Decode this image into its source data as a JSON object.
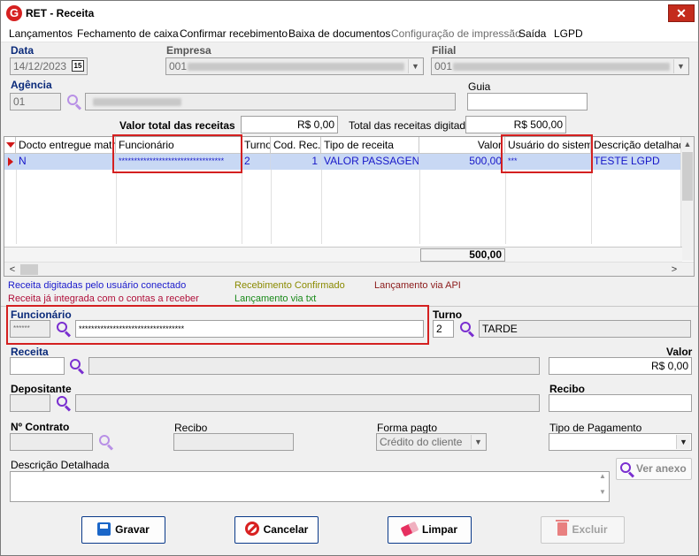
{
  "window": {
    "title": "RET - Receita",
    "icon_letter": "G",
    "close_glyph": "✕"
  },
  "menu": [
    "Lançamentos",
    "Fechamento de caixa",
    "Confirmar recebimento",
    "Baixa de documentos",
    "Configuração de impressão",
    "Saída",
    "LGPD"
  ],
  "menu_disabled_index": 4,
  "header": {
    "data_label": "Data",
    "data_value": "14/12/2023",
    "calendar_day": "15",
    "empresa_label": "Empresa",
    "empresa_code": "001",
    "filial_label": "Filial",
    "filial_code": "001",
    "agencia_label": "Agência",
    "agencia_code": "01",
    "guia_label": "Guia",
    "guia_value": ""
  },
  "totals": {
    "valor_total_label": "Valor total das receitas",
    "valor_total_value": "R$ 0,00",
    "total_digitadas_label": "Total das receitas digitadas",
    "total_digitadas_value": "R$ 500,00"
  },
  "grid": {
    "columns": [
      "Docto entregue matriz",
      "Funcionário",
      "Turno",
      "Cod. Rec.",
      "Tipo de receita",
      "Valor",
      "Usuário do sistema",
      "Descrição detalhada"
    ],
    "rows": [
      [
        "N",
        "**********************************",
        "2",
        "1",
        "VALOR PASSAGEN...",
        "500,00",
        "***",
        "TESTE LGPD"
      ]
    ],
    "sum_value": "500,00",
    "scroll_left": "<",
    "scroll_right": ">"
  },
  "legend": {
    "item1": "Receita digitadas pelo usuário conectado",
    "item2": "Receita já integrada com o contas a receber",
    "item3": "Recebimento Confirmado",
    "item4": "Lançamento via txt",
    "item5": "Lançamento via API",
    "color1": "#1a1acc",
    "color2": "#b0103a",
    "color3": "#8a8a00",
    "color4": "#1a8a1a",
    "color5": "#8b1a1a"
  },
  "form": {
    "funcionario_label": "Funcionário",
    "funcionario_code": "******",
    "funcionario_name": "**********************************",
    "turno_label": "Turno",
    "turno_code": "2",
    "turno_name": "TARDE",
    "receita_label": "Receita",
    "receita_code": "",
    "receita_name": "",
    "valor_label": "Valor",
    "valor_value": "R$ 0,00",
    "depositante_label": "Depositante",
    "depositante_code": "",
    "depositante_name": "",
    "recibo_label": "Recibo",
    "recibo_value": "",
    "contrato_label": "Nº Contrato",
    "contrato_value": "",
    "recibo2_label": "Recibo",
    "recibo2_value": "",
    "forma_pagto_label": "Forma pagto",
    "forma_pagto_value": "Crédito do cliente",
    "tipo_pagamento_label": "Tipo de Pagamento",
    "tipo_pagamento_value": "",
    "descricao_label": "Descrição Detalhada",
    "descricao_value": "",
    "ver_anexo_label": "Ver anexo"
  },
  "buttons": {
    "gravar": "Gravar",
    "cancelar": "Cancelar",
    "limpar": "Limpar",
    "excluir": "Excluir"
  },
  "colors": {
    "accent_navy": "#0a3a8a",
    "highlight_red": "#d42020",
    "selected_row": "#c8d8f4",
    "row_text": "#1717c8"
  }
}
